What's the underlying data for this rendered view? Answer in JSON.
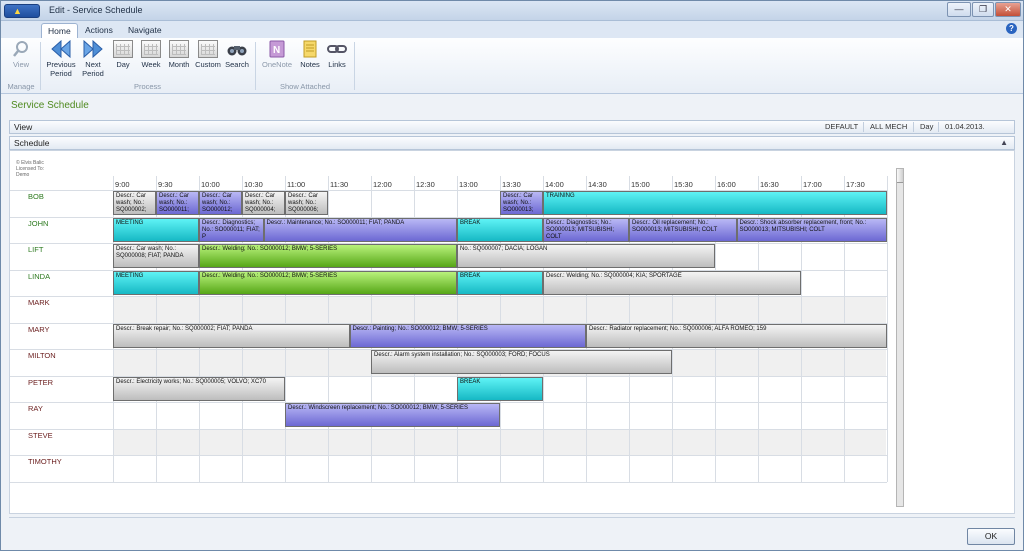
{
  "window": {
    "title": "Edit - Service Schedule",
    "app_button": "▲",
    "controls": [
      "—",
      "❐",
      "✕"
    ]
  },
  "ribbon": {
    "tabs": [
      "Home",
      "Actions",
      "Navigate"
    ],
    "active_tab": "Home",
    "help": "?",
    "manage": {
      "label": "Manage",
      "view": "View"
    },
    "process": {
      "label": "Process",
      "previous_period": "Previous Period",
      "next_period": "Next Period",
      "day": "Day",
      "week": "Week",
      "month": "Month",
      "custom": "Custom",
      "search": "Search"
    },
    "show_attached": {
      "label": "Show Attached",
      "onenote": "OneNote",
      "notes": "Notes",
      "links": "Links"
    }
  },
  "page": {
    "title": "Service Schedule"
  },
  "view_section": {
    "label": "View",
    "fields": [
      "DEFAULT",
      "ALL MECH",
      "Day",
      "01.04.2013."
    ]
  },
  "schedule_section": {
    "label": "Schedule",
    "chevron": "▲"
  },
  "schedule": {
    "license": [
      "© Elvis Balic",
      "Licensed To:",
      "Demo"
    ],
    "times": [
      "9:00",
      "9:30",
      "10:00",
      "10:30",
      "11:00",
      "11:30",
      "12:00",
      "12:30",
      "13:00",
      "13:30",
      "14:00",
      "14:30",
      "15:00",
      "15:30",
      "16:00",
      "16:30",
      "17:00",
      "17:30"
    ],
    "resources": [
      "BOB",
      "JOHN",
      "LIFT",
      "LINDA",
      "MARK",
      "MARY",
      "MILTON",
      "PETER",
      "RAY",
      "STEVE",
      "TIMOTHY"
    ],
    "gray_rows": [
      "MARK",
      "MILTON",
      "STEVE"
    ],
    "bookings": [
      {
        "row": "BOB",
        "start": "9:00",
        "end": "9:30",
        "color": "gray",
        "text": "Descr.: Car wash; No.: SQ000002;"
      },
      {
        "row": "BOB",
        "start": "9:30",
        "end": "10:00",
        "color": "purple",
        "text": "Descr.: Car wash; No.: SO000011;"
      },
      {
        "row": "BOB",
        "start": "10:00",
        "end": "10:30",
        "color": "purple",
        "text": "Descr.: Car wash; No.: SO000012;"
      },
      {
        "row": "BOB",
        "start": "10:30",
        "end": "11:00",
        "color": "gray",
        "text": "Descr.: Car wash; No.: SQ000004;"
      },
      {
        "row": "BOB",
        "start": "11:00",
        "end": "11:30",
        "color": "gray",
        "text": "Descr.: Car wash; No.: SQ000006;"
      },
      {
        "row": "BOB",
        "start": "13:30",
        "end": "14:00",
        "color": "purple",
        "text": "Descr.: Car wash; No.: SO000013;"
      },
      {
        "row": "BOB",
        "start": "14:00",
        "end": "18:00",
        "color": "cyan",
        "text": "TRAINING"
      },
      {
        "row": "JOHN",
        "start": "9:00",
        "end": "10:00",
        "color": "cyan",
        "text": "MEETING"
      },
      {
        "row": "JOHN",
        "start": "10:00",
        "end": "10:45",
        "color": "purple",
        "text": "Descr.: Diagnostics; No.: SO000011; FIAT; P"
      },
      {
        "row": "JOHN",
        "start": "10:45",
        "end": "13:00",
        "color": "purple",
        "text": "Descr.: Maintenance; No.: SO000011; FIAT; PANDA"
      },
      {
        "row": "JOHN",
        "start": "13:00",
        "end": "14:00",
        "color": "cyan",
        "text": "BREAK"
      },
      {
        "row": "JOHN",
        "start": "14:00",
        "end": "15:00",
        "color": "purple",
        "text": "Descr.: Diagnostics; No.: SO000013; MITSUBISHI; COLT"
      },
      {
        "row": "JOHN",
        "start": "15:00",
        "end": "16:15",
        "color": "purple",
        "text": "Descr.: Oil replacement; No.: SO000013; MITSUBISHI; COLT"
      },
      {
        "row": "JOHN",
        "start": "16:15",
        "end": "18:00",
        "color": "purple",
        "text": "Descr.: Shock absorber replacement, front; No.: SO000013; MITSUBISHI; COLT"
      },
      {
        "row": "LIFT",
        "start": "9:00",
        "end": "10:00",
        "color": "gray",
        "text": "Descr.: Car wash; No.: SQ000008; FIAT; PANDA"
      },
      {
        "row": "LIFT",
        "start": "10:00",
        "end": "13:00",
        "color": "green",
        "text": "Descr.: Welding; No.: SO000012; BMW; 5-SERIES"
      },
      {
        "row": "LIFT",
        "start": "13:00",
        "end": "16:00",
        "color": "gray",
        "text": "No.: SQ000007; DACIA; LOGAN"
      },
      {
        "row": "LINDA",
        "start": "9:00",
        "end": "10:00",
        "color": "cyan",
        "text": "MEETING"
      },
      {
        "row": "LINDA",
        "start": "10:00",
        "end": "13:00",
        "color": "green",
        "text": "Descr.: Welding; No.: SO000012; BMW; 5-SERIES"
      },
      {
        "row": "LINDA",
        "start": "13:00",
        "end": "14:00",
        "color": "cyan",
        "text": "BREAK"
      },
      {
        "row": "LINDA",
        "start": "14:00",
        "end": "17:00",
        "color": "gray",
        "text": "Descr.: Welding; No.: SQ000004; KIA; SPORTAGE"
      },
      {
        "row": "MARY",
        "start": "9:00",
        "end": "11:45",
        "color": "gray",
        "text": "Descr.: Break repair; No.: SQ000002; FIAT; PANDA"
      },
      {
        "row": "MARY",
        "start": "11:45",
        "end": "14:30",
        "color": "purple",
        "text": "Descr.: Painting; No.: SO000012; BMW; 5-SERIES"
      },
      {
        "row": "MARY",
        "start": "14:30",
        "end": "18:00",
        "color": "gray",
        "text": "Descr.: Radiator replacement; No.: SQ000006; ALFA ROMEO; 159"
      },
      {
        "row": "MILTON",
        "start": "12:00",
        "end": "15:30",
        "color": "gray",
        "text": "Descr.: Alarm system installation; No.: SQ000003; FORD; FOCUS"
      },
      {
        "row": "PETER",
        "start": "9:00",
        "end": "11:00",
        "color": "gray",
        "text": "Descr.: Electricity works; No.: SQ000005; VOLVO; XC70"
      },
      {
        "row": "PETER",
        "start": "13:00",
        "end": "14:00",
        "color": "cyan",
        "text": "BREAK"
      },
      {
        "row": "RAY",
        "start": "11:00",
        "end": "13:30",
        "color": "purple",
        "text": "Descr.: Windscreen replacement; No.: SO000012; BMW; 5-SERIES"
      }
    ]
  },
  "footer": {
    "ok": "OK"
  }
}
